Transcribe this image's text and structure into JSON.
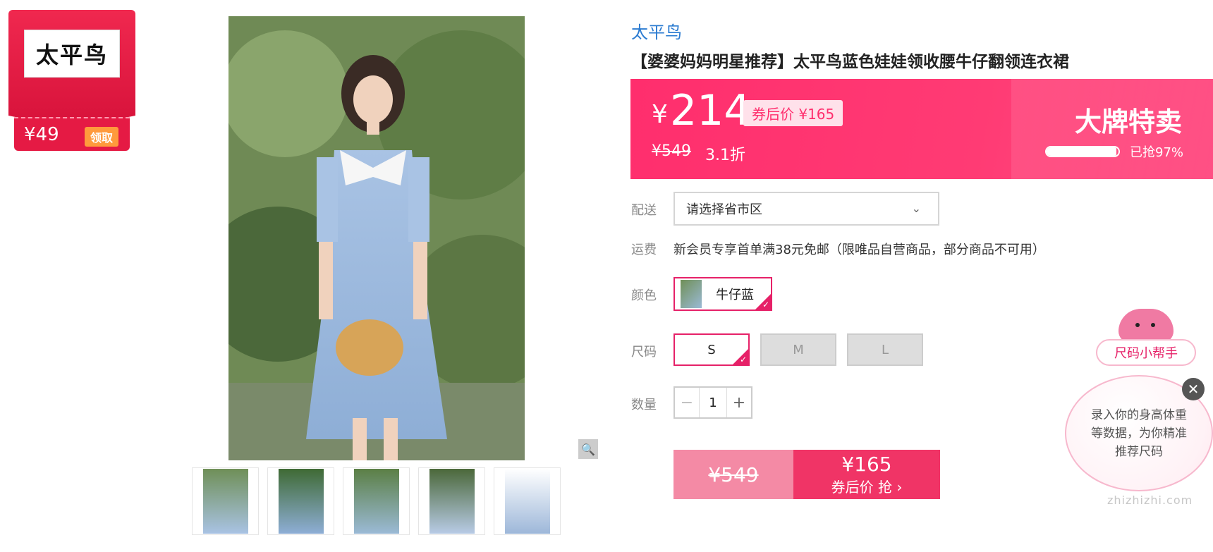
{
  "coupon": {
    "brand_logo_text": "太平鸟",
    "amount": "¥49",
    "action_label": "领取"
  },
  "product": {
    "brand": "太平鸟",
    "title": "【婆婆妈妈明星推荐】太平鸟蓝色娃娃领收腰牛仔翻领连衣裙",
    "price_symbol": "¥",
    "price": "214",
    "after_coupon_tag": "券后价 ¥165",
    "original_price": "¥549",
    "discount": "3.1折",
    "sale_title": "大牌特卖",
    "sold_text": "已抢97%",
    "sold_progress": 0.97
  },
  "delivery": {
    "label": "配送",
    "select_value": "请选择省市区"
  },
  "shipping": {
    "label": "运费",
    "text": "新会员专享首单满38元免邮（限唯品自营商品，部分商品不可用）"
  },
  "color": {
    "label": "颜色",
    "options": [
      {
        "name": "牛仔蓝",
        "selected": true
      }
    ]
  },
  "size": {
    "label": "尺码",
    "options": [
      {
        "name": "S",
        "selected": true
      },
      {
        "name": "M",
        "selected": false
      },
      {
        "name": "L",
        "selected": false
      }
    ]
  },
  "quantity": {
    "label": "数量",
    "value": "1",
    "minus": "−",
    "plus": "+"
  },
  "buy": {
    "original_price": "¥549",
    "coupon_price": "¥165",
    "action_label": "券后价 抢 ›"
  },
  "size_helper": {
    "title": "尺码小帮手",
    "text": "录入你的身高体重等数据，为你精准推荐尺码",
    "close_symbol": "✕"
  },
  "zoom_icon": "🔍",
  "watermark": "zhizhizhi.com",
  "colors": {
    "brand_blue": "#2b7bd1",
    "accent_pink": "#ff2e6d",
    "selected_border": "#e62168",
    "buy_left": "#f48aa5",
    "buy_right": "#f03466"
  },
  "icons": {
    "zoom": "search-icon",
    "dropdown": "chevron-down-icon",
    "close": "close-icon"
  }
}
